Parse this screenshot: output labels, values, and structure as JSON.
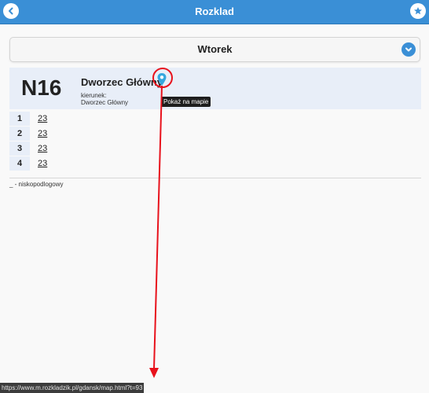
{
  "header": {
    "title": "Rozklad",
    "back_icon": "chevron-left-icon",
    "star_icon": "star-icon"
  },
  "day_select": {
    "value": "Wtorek",
    "icon": "chevron-down-icon"
  },
  "route": {
    "line": "N16",
    "stop": "Dworzec Główny",
    "direction_label": "kierunek:",
    "direction": "Dworzec Główny",
    "map_icon": "map-pin-icon",
    "tooltip": "Pokaż na mapie"
  },
  "timetable": [
    {
      "hour": "1",
      "minutes": "23"
    },
    {
      "hour": "2",
      "minutes": "23"
    },
    {
      "hour": "3",
      "minutes": "23"
    },
    {
      "hour": "4",
      "minutes": "23"
    }
  ],
  "legend": "_ - niskopodlogowy",
  "status_url": "https://www.m.rozkladzik.pl/gdansk/map.html?t=93",
  "colors": {
    "accent": "#3a8fd6",
    "panel": "#e8eef8",
    "annotation": "#e8121c"
  }
}
